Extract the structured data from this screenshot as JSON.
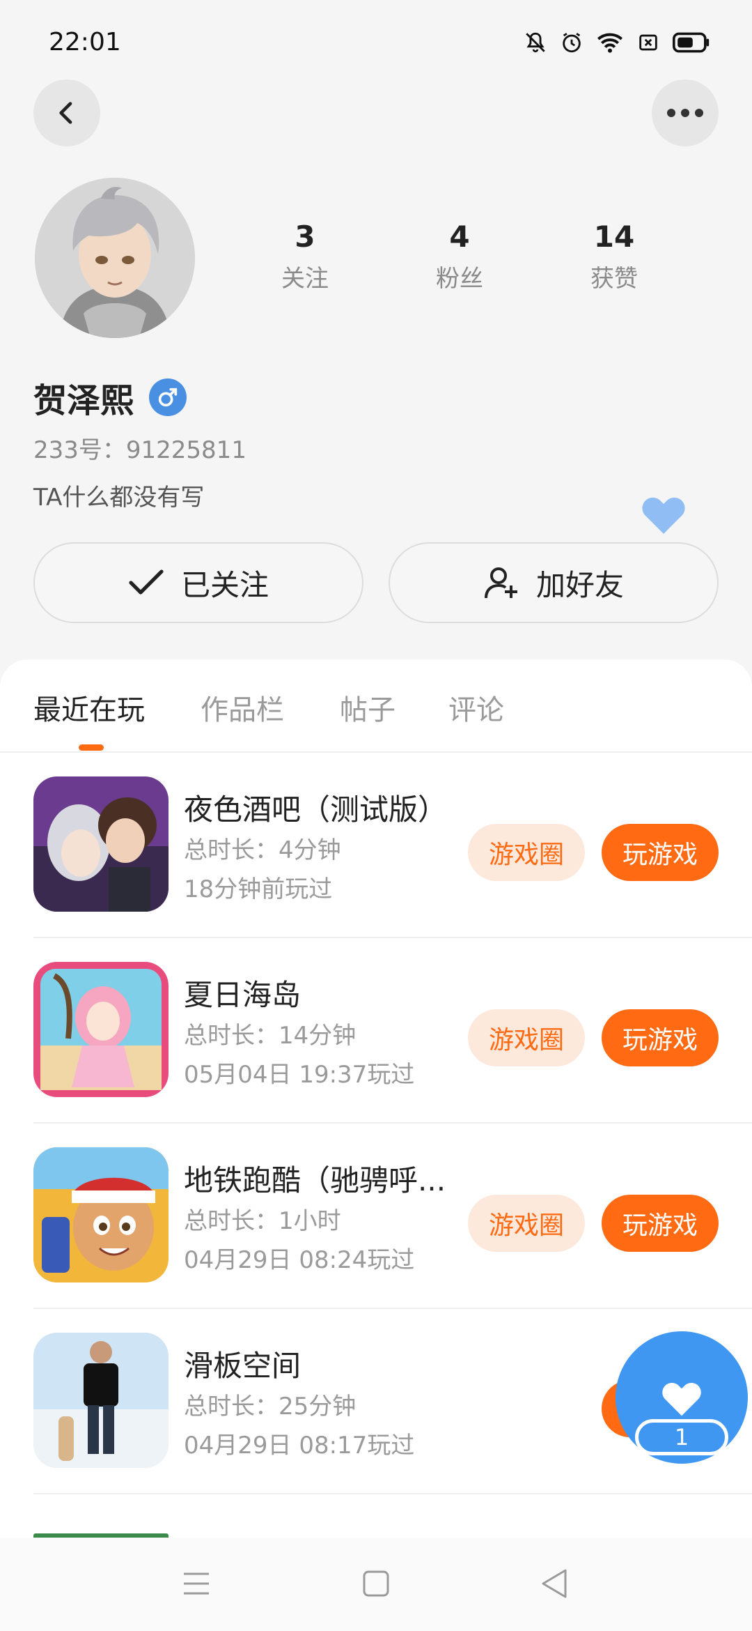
{
  "status_bar": {
    "time": "22:01"
  },
  "profile": {
    "stats": [
      {
        "value": "3",
        "label": "关注"
      },
      {
        "value": "4",
        "label": "粉丝"
      },
      {
        "value": "14",
        "label": "获赞"
      }
    ],
    "nickname": "贺泽熙",
    "uid": "233号：91225811",
    "bio": "TA什么都没有写",
    "follow_label": "已关注",
    "add_friend_label": "加好友"
  },
  "tabs": [
    {
      "label": "最近在玩",
      "active": true
    },
    {
      "label": "作品栏",
      "active": false
    },
    {
      "label": "帖子",
      "active": false
    },
    {
      "label": "评论",
      "active": false
    }
  ],
  "games": [
    {
      "title": "夜色酒吧（测试版）",
      "duration": "总时长：4分钟",
      "last_played": "18分钟前玩过",
      "circle_label": "游戏圈",
      "play_label": "玩游戏"
    },
    {
      "title": "夏日海岛",
      "duration": "总时长：14分钟",
      "last_played": "05月04日 19:37玩过",
      "circle_label": "游戏圈",
      "play_label": "玩游戏"
    },
    {
      "title": "地铁跑酷（驰骋呼...",
      "duration": "总时长：1小时",
      "last_played": "04月29日 08:24玩过",
      "circle_label": "游戏圈",
      "play_label": "玩游戏"
    },
    {
      "title": "滑板空间",
      "duration": "总时长：25分钟",
      "last_played": "04月29日 08:17玩过",
      "circle_label": "",
      "play_label": ""
    }
  ],
  "fab": {
    "badge": "1"
  },
  "colors": {
    "accent": "#ff6a13",
    "accent_light": "#fde9dc",
    "blue": "#3f97f2"
  }
}
